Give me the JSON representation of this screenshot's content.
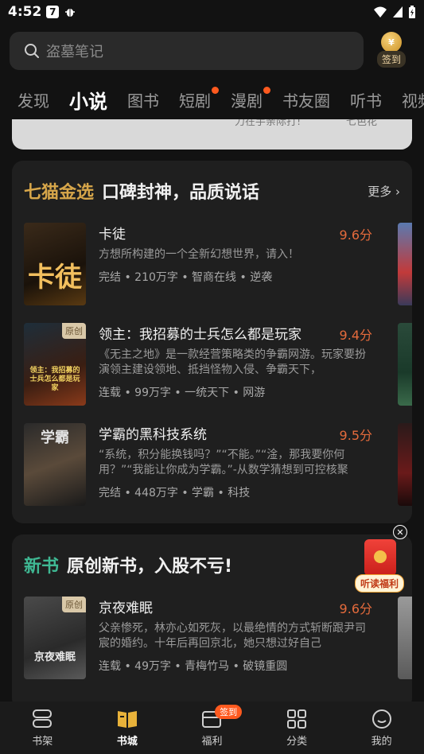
{
  "status_bar": {
    "time": "4:52",
    "app_badge": "7"
  },
  "search": {
    "placeholder": "盗墓笔记"
  },
  "signin": {
    "coin": "¥",
    "label": "签到"
  },
  "tabs": [
    {
      "label": "发现"
    },
    {
      "label": "小说",
      "active": true
    },
    {
      "label": "图书"
    },
    {
      "label": "短剧",
      "dot": true
    },
    {
      "label": "漫剧",
      "dot": true
    },
    {
      "label": "书友圈"
    },
    {
      "label": "听书"
    },
    {
      "label": "视频"
    }
  ],
  "prev_card": {
    "fragments": [
      "力在手亲际打!",
      "七色花"
    ]
  },
  "section1": {
    "tag": "七猫金选",
    "tag_color": "#d7a64a",
    "title": "口碑封神，品质说话",
    "more": "更多 ›",
    "books": [
      {
        "title": "卡徒",
        "score": "9.6分",
        "desc": "方想所构建的一个全新幻想世界，请入！",
        "meta": "完结 • 210万字 • 智商在线 • 逆袭",
        "cover_text": "卡徒",
        "original": ""
      },
      {
        "title": "领主：我招募的士兵怎么都是玩家",
        "score": "9.4分",
        "desc": "《无主之地》是一款经营策略类的争霸网游。玩家要扮演领主建设领地、抵挡怪物入侵、争霸天下，",
        "meta": "连载 • 99万字 • 一统天下 • 网游",
        "cover_text": "领主：我招募的士兵怎么都是玩家",
        "original": "原创"
      },
      {
        "title": "学霸的黑科技系统",
        "score": "9.5分",
        "desc": "“系统，积分能换钱吗？”“不能。”“淦，那我要你何用？”“我能让你成为学霸。”-从数学猜想到可控核聚",
        "meta": "完结 • 448万字 • 学霸 • 科技",
        "cover_text": "学霸",
        "original": ""
      }
    ]
  },
  "section2": {
    "tag": "新书",
    "tag_color": "#3fb893",
    "title": "原创新书，入股不亏!",
    "books": [
      {
        "title": "京夜难眠",
        "score": "9.6分",
        "desc": "父亲惨死，林亦心如死灰，以最绝情的方式斩断跟尹司宸的婚约。十年后再回京北，她只想过好自己",
        "meta": "连载 • 49万字 • 青梅竹马 • 破镜重圆",
        "cover_text": "京夜难眠",
        "original": "原创"
      }
    ]
  },
  "reward": {
    "label": "听读福利",
    "close": "✕"
  },
  "bottom_nav": [
    {
      "label": "书架",
      "icon": "bookshelf-icon"
    },
    {
      "label": "书城",
      "icon": "book-open-icon",
      "active": true
    },
    {
      "label": "福利",
      "icon": "gift-box-icon",
      "badge": "签到"
    },
    {
      "label": "分类",
      "icon": "grid-icon"
    },
    {
      "label": "我的",
      "icon": "profile-icon"
    }
  ]
}
